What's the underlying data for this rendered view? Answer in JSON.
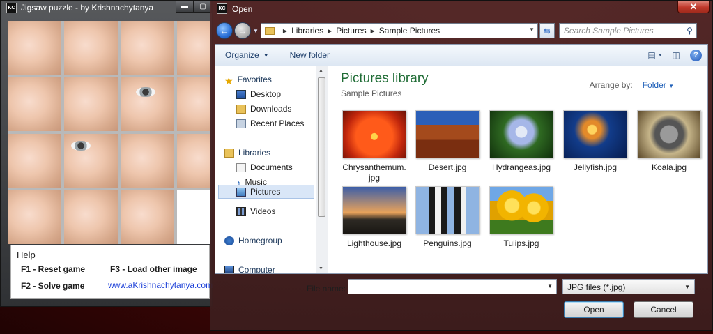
{
  "jigsaw": {
    "title": "Jigsaw puzzle - by Krishnachytanya",
    "icon_text": "KC",
    "help": {
      "heading": "Help",
      "reset": "F1 - Reset game",
      "solve": "F2 - Solve game",
      "load": "F3 - Load other image",
      "link": "www.aKrishnachytanya.com"
    }
  },
  "dialog": {
    "title": "Open",
    "icon_text": "KC",
    "close_glyph": "✕",
    "breadcrumb": [
      "Libraries",
      "Pictures",
      "Sample Pictures"
    ],
    "search_placeholder": "Search Sample Pictures",
    "toolbar": {
      "organize": "Organize",
      "new_folder": "New folder"
    },
    "nav": {
      "favorites": "Favorites",
      "favorites_items": [
        "Desktop",
        "Downloads",
        "Recent Places"
      ],
      "libraries": "Libraries",
      "libraries_items": [
        "Documents",
        "Music",
        "Pictures",
        "Videos"
      ],
      "selected": "Pictures",
      "homegroup": "Homegroup",
      "computer": "Computer"
    },
    "library": {
      "title": "Pictures library",
      "subtitle": "Sample Pictures",
      "arrange_label": "Arrange by:",
      "arrange_value": "Folder"
    },
    "files": [
      {
        "name": "Chrysanthemum.\njpg",
        "icon": "chrysanthemum-thumbnail"
      },
      {
        "name": "Desert.jpg",
        "icon": "desert-thumbnail"
      },
      {
        "name": "Hydrangeas.jpg",
        "icon": "hydrangeas-thumbnail"
      },
      {
        "name": "Jellyfish.jpg",
        "icon": "jellyfish-thumbnail"
      },
      {
        "name": "Koala.jpg",
        "icon": "koala-thumbnail"
      },
      {
        "name": "Lighthouse.jpg",
        "icon": "lighthouse-thumbnail"
      },
      {
        "name": "Penguins.jpg",
        "icon": "penguins-thumbnail"
      },
      {
        "name": "Tulips.jpg",
        "icon": "tulips-thumbnail"
      }
    ],
    "file_name_label": "File name:",
    "file_name_value": "",
    "filter_value": "JPG files (*.jpg)",
    "open_label": "Open",
    "cancel_label": "Cancel"
  }
}
